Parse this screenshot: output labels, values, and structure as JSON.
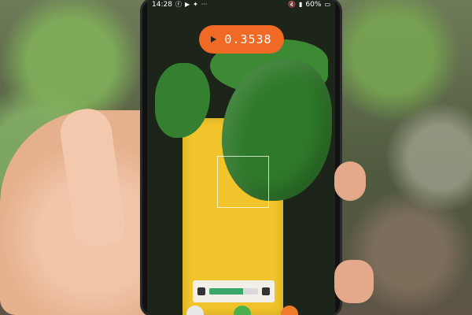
{
  "statusbar": {
    "time": "14:28",
    "icons": [
      "facebook-icon",
      "youtube-icon",
      "twitter-icon",
      "more-icon"
    ],
    "right_icons": [
      "mute-icon",
      "signal-icon",
      "battery-icon"
    ],
    "battery": "60%"
  },
  "result": {
    "value": "0.3538",
    "play_icon": "play-icon"
  },
  "bottom_card": {
    "progress": 0.7
  },
  "colors": {
    "result_pill": "#f06a26",
    "board": "#f1c42b",
    "leaf": "#2f7a2a"
  }
}
